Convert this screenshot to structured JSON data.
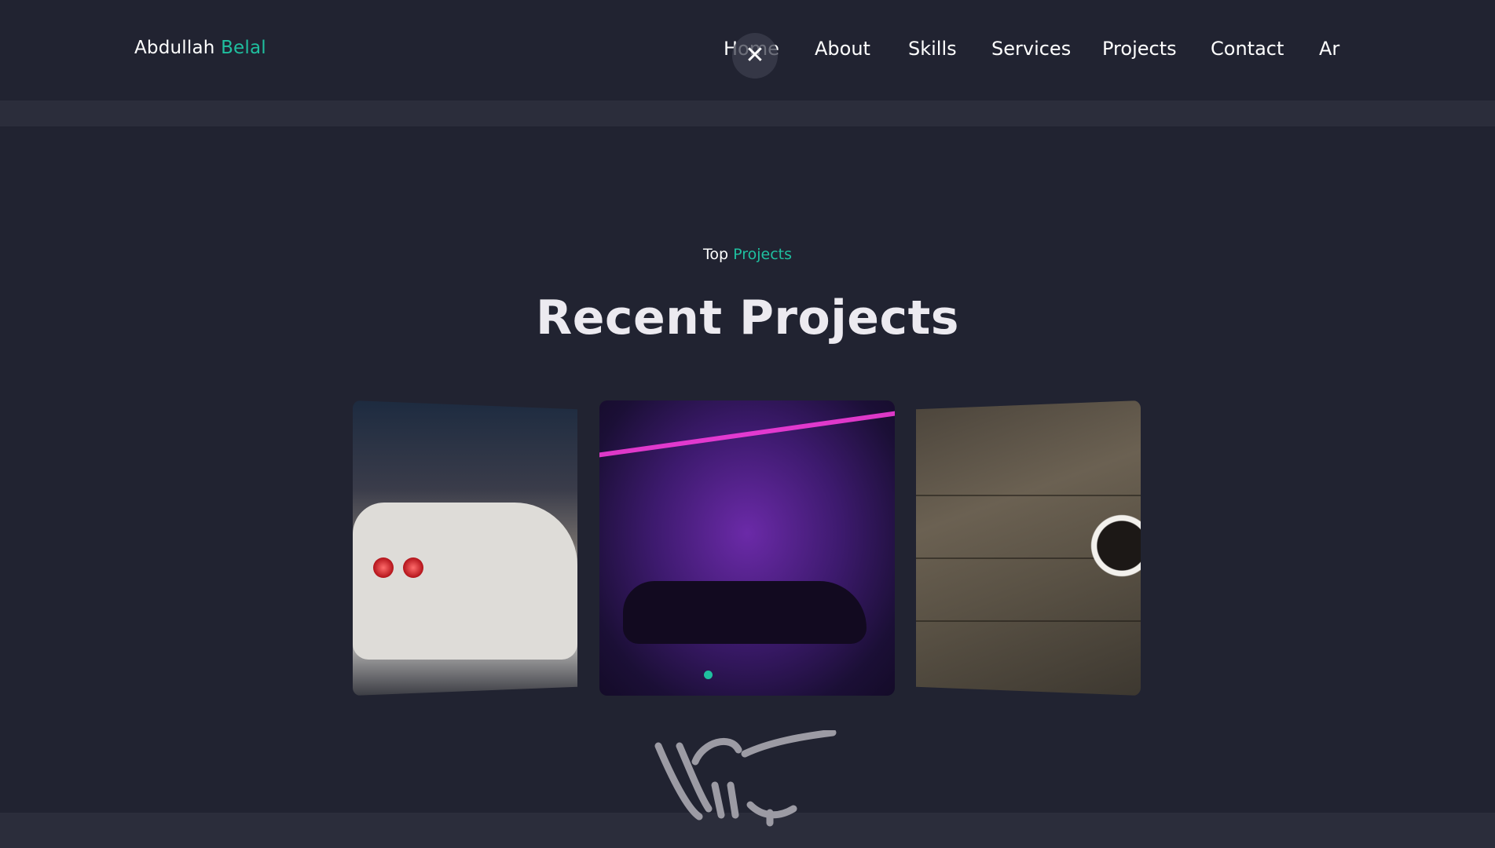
{
  "header": {
    "logo_first": "Abdullah",
    "logo_second": "Belal",
    "nav": [
      "Home",
      "About",
      "Skills",
      "Services",
      "Projects",
      "Contact",
      "Ar"
    ],
    "close_icon": "close-icon"
  },
  "section": {
    "eyebrow_first": "Top",
    "eyebrow_second": "Projects",
    "title": "Recent Projects"
  },
  "projects": [
    {
      "image": "white-sports-car-at-night"
    },
    {
      "image": "neon-gas-station-muscle-car"
    },
    {
      "image": "wooden-desk-glasses-coffee"
    }
  ],
  "slider": {
    "active_index": 0
  },
  "signature": "arabic-calligraphy-signature",
  "colors": {
    "background": "#212331",
    "band": "#2b2d3b",
    "accent": "#1fbf9f",
    "text": "#ffffff"
  }
}
